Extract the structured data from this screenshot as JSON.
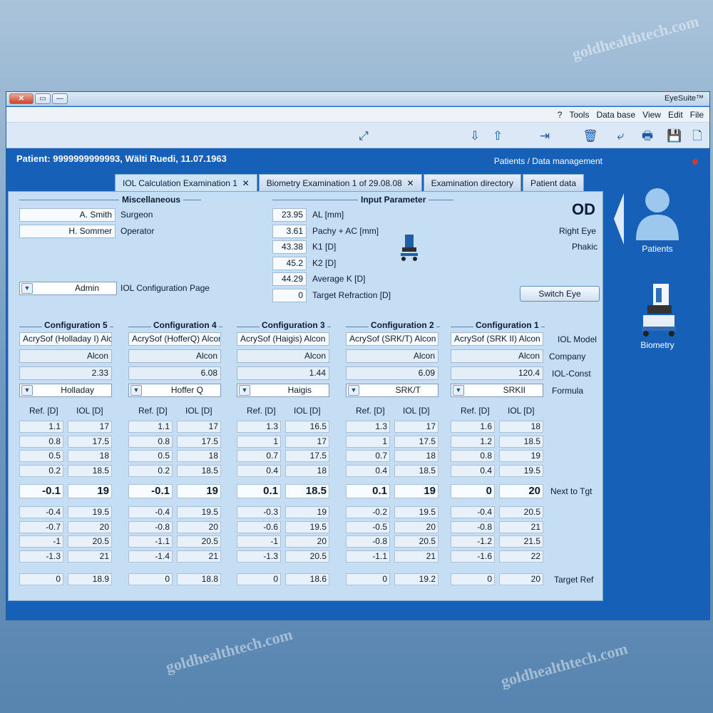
{
  "watermark": "goldhealthtech.com",
  "window": {
    "title": "EyeSuite™",
    "close_glyph": "✕",
    "restore_glyph": "▭",
    "min_glyph": "—"
  },
  "menu": [
    "File",
    "Edit",
    "View",
    "Data base",
    "Tools",
    "?"
  ],
  "patient": "Patient: 9999999999993, Wälti Ruedi, 11.07.1963",
  "section_title": "Patients / Data management",
  "tabs": [
    {
      "label": "Patient data"
    },
    {
      "label": "Examination directory"
    },
    {
      "label": "Biometry Examination 1 of 29.08.08",
      "close": "✕"
    },
    {
      "label": "IOL Calculation Examination 1",
      "close": "✕"
    }
  ],
  "sidebar": {
    "patients": "Patients",
    "biometry": "Biometry"
  },
  "eye": {
    "side": "OD",
    "label": "Right Eye",
    "lens": "Phakic",
    "switch_button": "Switch Eye"
  },
  "input_parameter": {
    "title": "Input Parameter",
    "rows": [
      {
        "label": "AL [mm]",
        "value": "23.95"
      },
      {
        "label": "Pachy + AC [mm]",
        "value": "3.61"
      },
      {
        "label": "K1 [D]",
        "value": "43.38"
      },
      {
        "label": "K2 [D]",
        "value": "45.2"
      },
      {
        "label": "Average K [D]",
        "value": "44.29"
      },
      {
        "label": "Target Refraction [D]",
        "value": "0"
      }
    ]
  },
  "misc": {
    "title": "Miscellaneous",
    "surgeon_label": "Surgeon",
    "surgeon": "A. Smith",
    "operator_label": "Operator",
    "operator": "H. Sommer",
    "config_page_label": "IOL Configuration Page",
    "config_page": "Admin"
  },
  "row_labels": {
    "model": "IOL Model",
    "company": "Company",
    "const": "IOL-Const",
    "formula": "Formula",
    "next": "Next to Tgt",
    "target": "Target Ref",
    "iol_col": "IOL [D]",
    "ref_col": "Ref. [D]"
  },
  "configs": [
    {
      "title": "Configuration 1",
      "model": "AcrySof (SRK II) Alcon",
      "company": "Alcon",
      "const": "120.4",
      "formula": "SRKII",
      "above": [
        [
          "18",
          "1.6"
        ],
        [
          "18.5",
          "1.2"
        ],
        [
          "19",
          "0.8"
        ],
        [
          "19.5",
          "0.4"
        ]
      ],
      "next": [
        "20",
        "0"
      ],
      "below": [
        [
          "20.5",
          "-0.4"
        ],
        [
          "21",
          "-0.8"
        ],
        [
          "21.5",
          "-1.2"
        ],
        [
          "22",
          "-1.6"
        ]
      ],
      "target": [
        "20",
        "0"
      ]
    },
    {
      "title": "Configuration 2",
      "model": "AcrySof (SRK/T) Alcon",
      "company": "Alcon",
      "const": "6.09",
      "formula": "SRK/T",
      "above": [
        [
          "17",
          "1.3"
        ],
        [
          "17.5",
          "1"
        ],
        [
          "18",
          "0.7"
        ],
        [
          "18.5",
          "0.4"
        ]
      ],
      "next": [
        "19",
        "0.1"
      ],
      "below": [
        [
          "19.5",
          "-0.2"
        ],
        [
          "20",
          "-0.5"
        ],
        [
          "20.5",
          "-0.8"
        ],
        [
          "21",
          "-1.1"
        ]
      ],
      "target": [
        "19.2",
        "0"
      ]
    },
    {
      "title": "Configuration 3",
      "model": "AcrySof (Haigis) Alcon",
      "company": "Alcon",
      "const": "1.44",
      "formula": "Haigis",
      "above": [
        [
          "16.5",
          "1.3"
        ],
        [
          "17",
          "1"
        ],
        [
          "17.5",
          "0.7"
        ],
        [
          "18",
          "0.4"
        ]
      ],
      "next": [
        "18.5",
        "0.1"
      ],
      "below": [
        [
          "19",
          "-0.3"
        ],
        [
          "19.5",
          "-0.6"
        ],
        [
          "20",
          "-1"
        ],
        [
          "20.5",
          "-1.3"
        ]
      ],
      "target": [
        "18.6",
        "0"
      ]
    },
    {
      "title": "Configuration 4",
      "model": "AcrySof (HofferQ) Alcon",
      "company": "Alcon",
      "const": "6.08",
      "formula": "Hoffer Q",
      "above": [
        [
          "17",
          "1.1"
        ],
        [
          "17.5",
          "0.8"
        ],
        [
          "18",
          "0.5"
        ],
        [
          "18.5",
          "0.2"
        ]
      ],
      "next": [
        "19",
        "-0.1"
      ],
      "below": [
        [
          "19.5",
          "-0.4"
        ],
        [
          "20",
          "-0.8"
        ],
        [
          "20.5",
          "-1.1"
        ],
        [
          "21",
          "-1.4"
        ]
      ],
      "target": [
        "18.8",
        "0"
      ]
    },
    {
      "title": "Configuration 5",
      "model": "AcrySof (Holladay I) Alcon",
      "company": "Alcon",
      "const": "2.33",
      "formula": "Holladay",
      "above": [
        [
          "17",
          "1.1"
        ],
        [
          "17.5",
          "0.8"
        ],
        [
          "18",
          "0.5"
        ],
        [
          "18.5",
          "0.2"
        ]
      ],
      "next": [
        "19",
        "-0.1"
      ],
      "below": [
        [
          "19.5",
          "-0.4"
        ],
        [
          "20",
          "-0.7"
        ],
        [
          "20.5",
          "-1"
        ],
        [
          "21",
          "-1.3"
        ]
      ],
      "target": [
        "18.9",
        "0"
      ]
    }
  ],
  "icons": [
    "new-document-icon",
    "save-icon",
    "print-icon",
    "merge-icon",
    "delete-icon",
    "export-icon",
    "upload-icon",
    "download-icon",
    "fullscreen-icon",
    "biometer-icon",
    "patient-avatar-icon"
  ]
}
